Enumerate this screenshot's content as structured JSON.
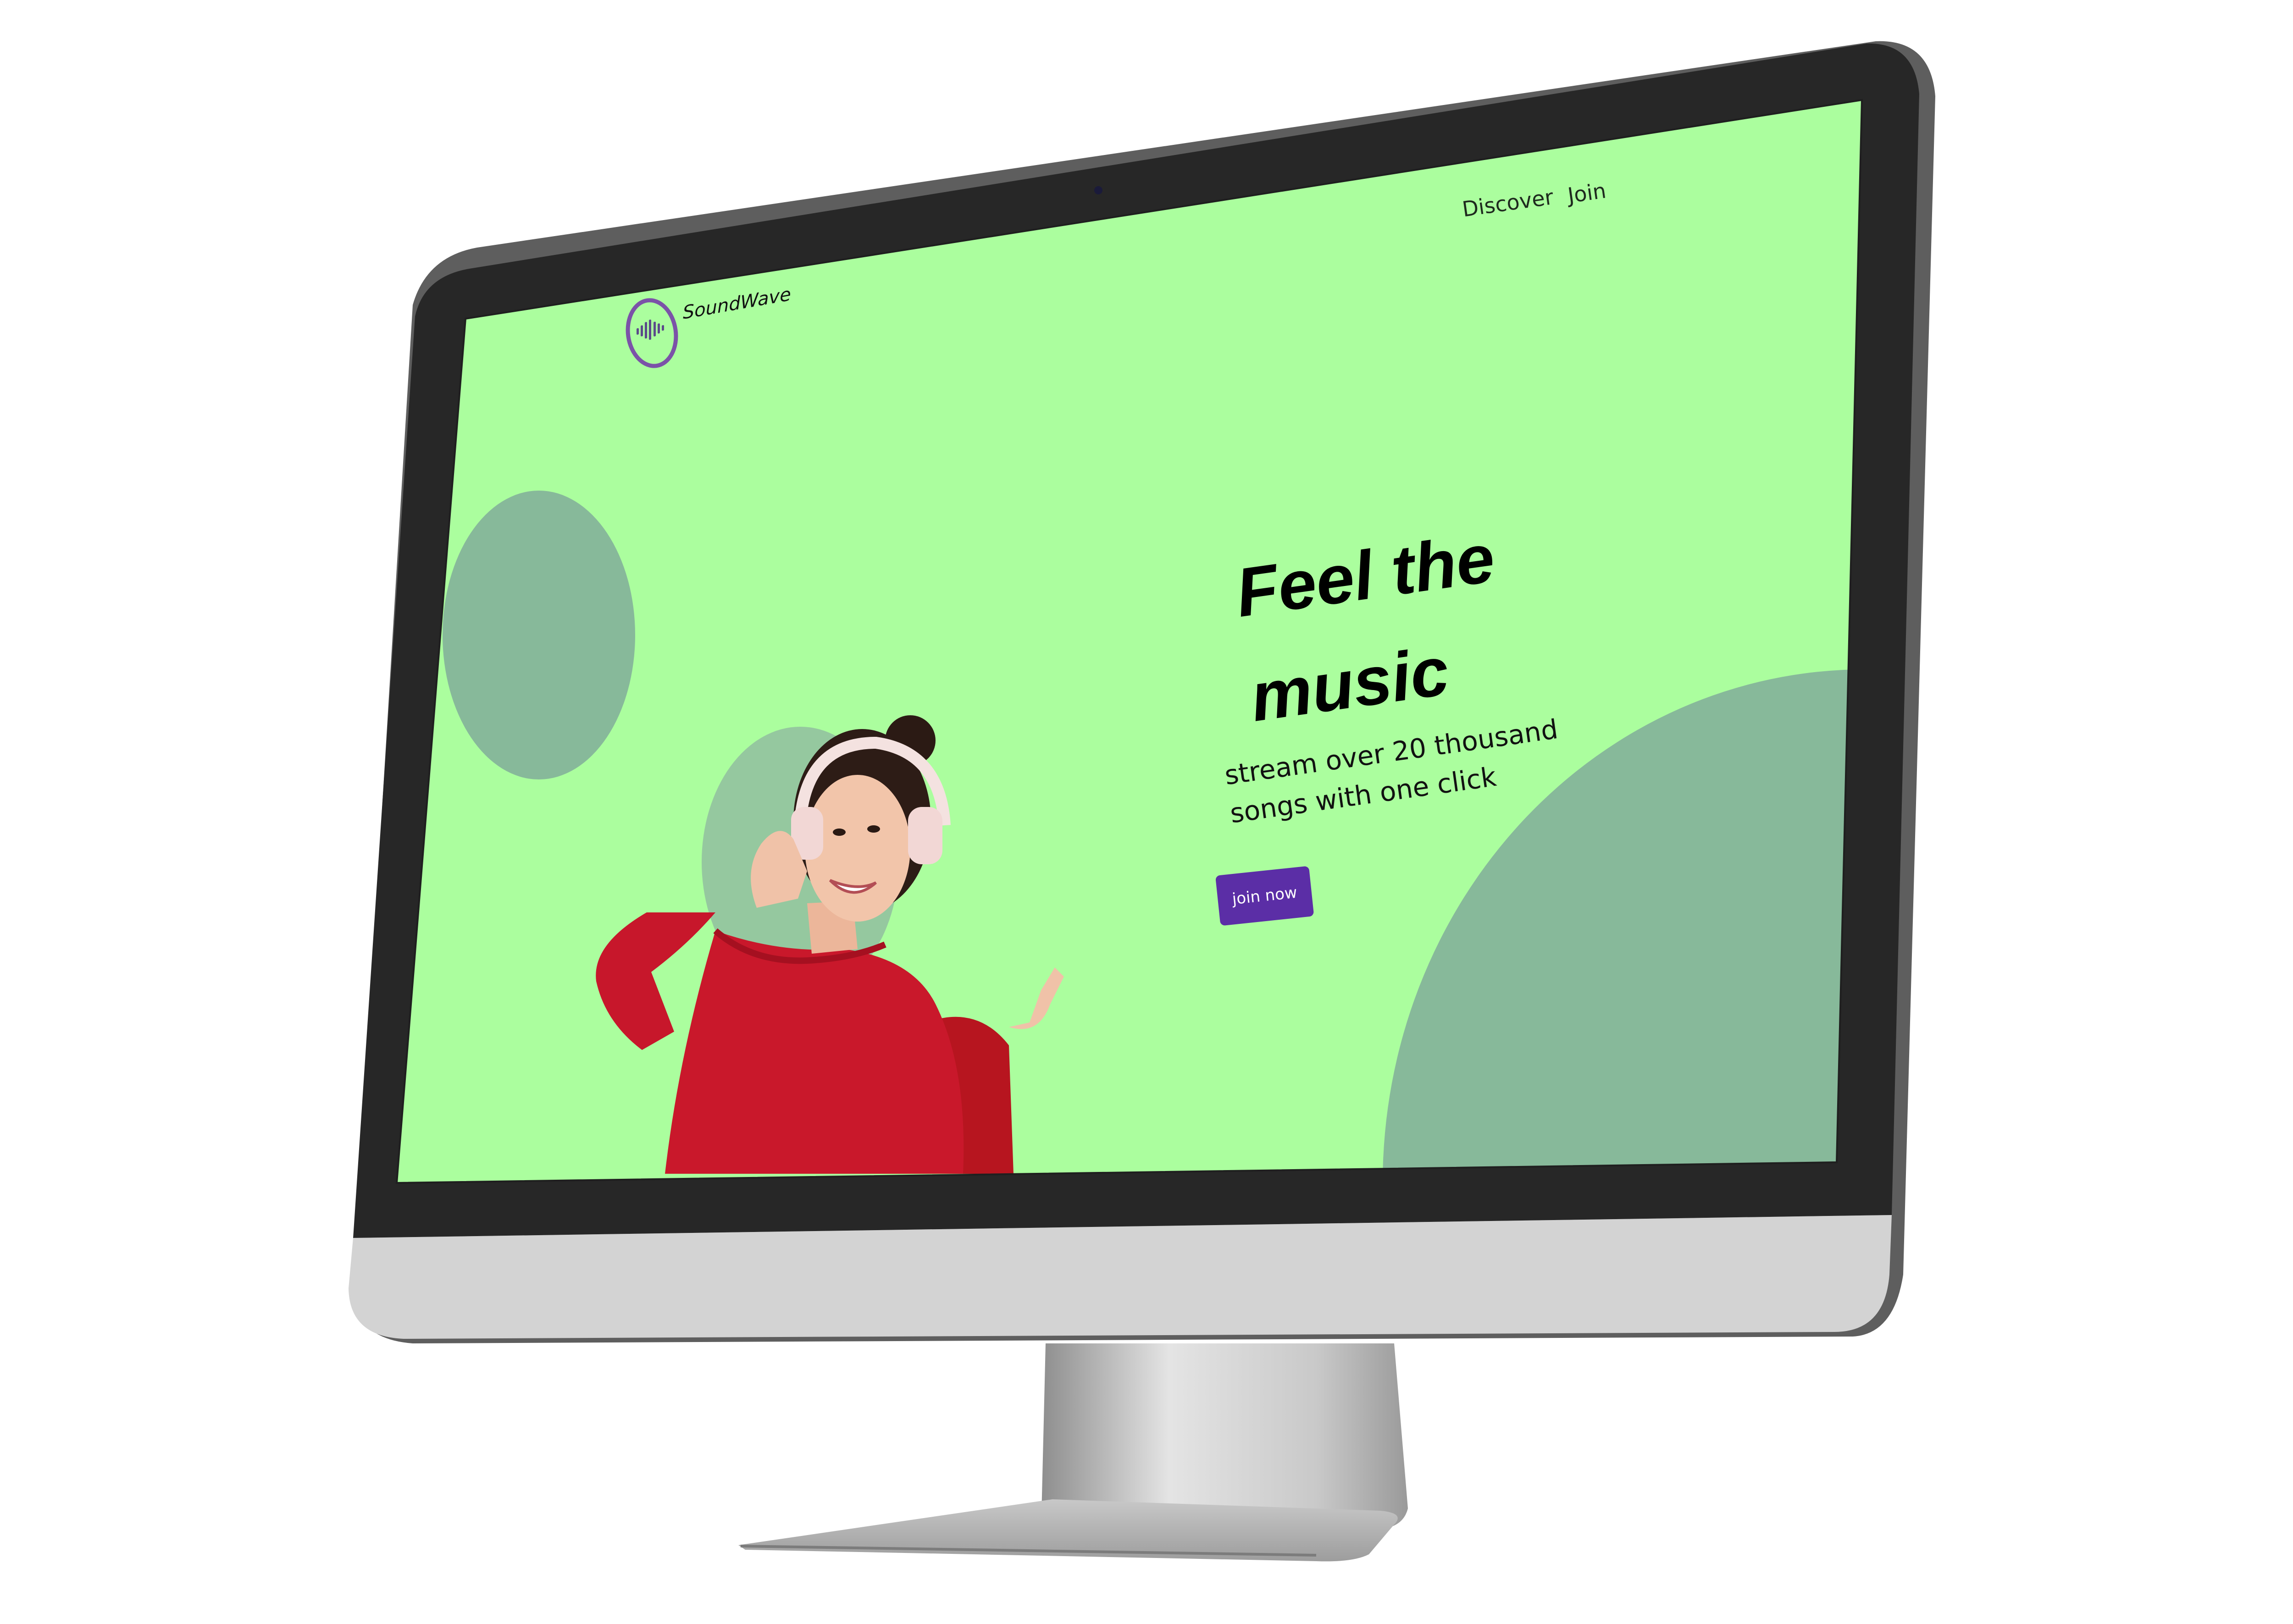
{
  "brand": {
    "name": "SoundWave",
    "logo_icon": "soundwave-logo-icon"
  },
  "nav": {
    "links": [
      {
        "label": "Discover"
      },
      {
        "label": "Join"
      }
    ]
  },
  "hero": {
    "title": "Feel the music",
    "subtitle": "stream over 20 thousand songs with one click",
    "cta_label": "join now"
  },
  "colors": {
    "screen_bg": "#abfe9e",
    "blob": "#87b99a",
    "cta_bg": "#5b2ea6",
    "logo_ring": "#7b52a8",
    "bezel": "#272727",
    "chin": "#d3d3d3"
  }
}
